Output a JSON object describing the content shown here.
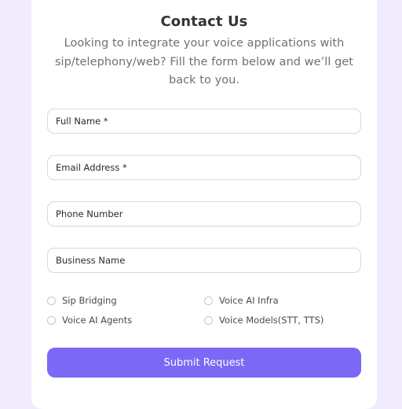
{
  "form": {
    "title": "Contact Us",
    "subtitle": "Looking to integrate your voice applications with sip/telephony/web? Fill the form below and we’ll get back to you.",
    "fields": {
      "full_name": {
        "placeholder": "Full Name *",
        "value": ""
      },
      "email": {
        "placeholder": "Email Address *",
        "value": ""
      },
      "phone": {
        "placeholder": "Phone Number",
        "value": ""
      },
      "business": {
        "placeholder": "Business Name",
        "value": ""
      }
    },
    "options": [
      {
        "label": "Sip Bridging",
        "selected": false
      },
      {
        "label": "Voice AI Infra",
        "selected": false
      },
      {
        "label": "Voice AI Agents",
        "selected": false
      },
      {
        "label": "Voice Models(STT, TTS)",
        "selected": false
      }
    ],
    "submit_label": "Submit Request"
  },
  "colors": {
    "page_background": "#f1ecfd",
    "card_background": "#ffffff",
    "accent": "#7b68f5",
    "title_text": "#333333",
    "subtitle_text": "#707070",
    "input_border": "#d9d9dc"
  }
}
